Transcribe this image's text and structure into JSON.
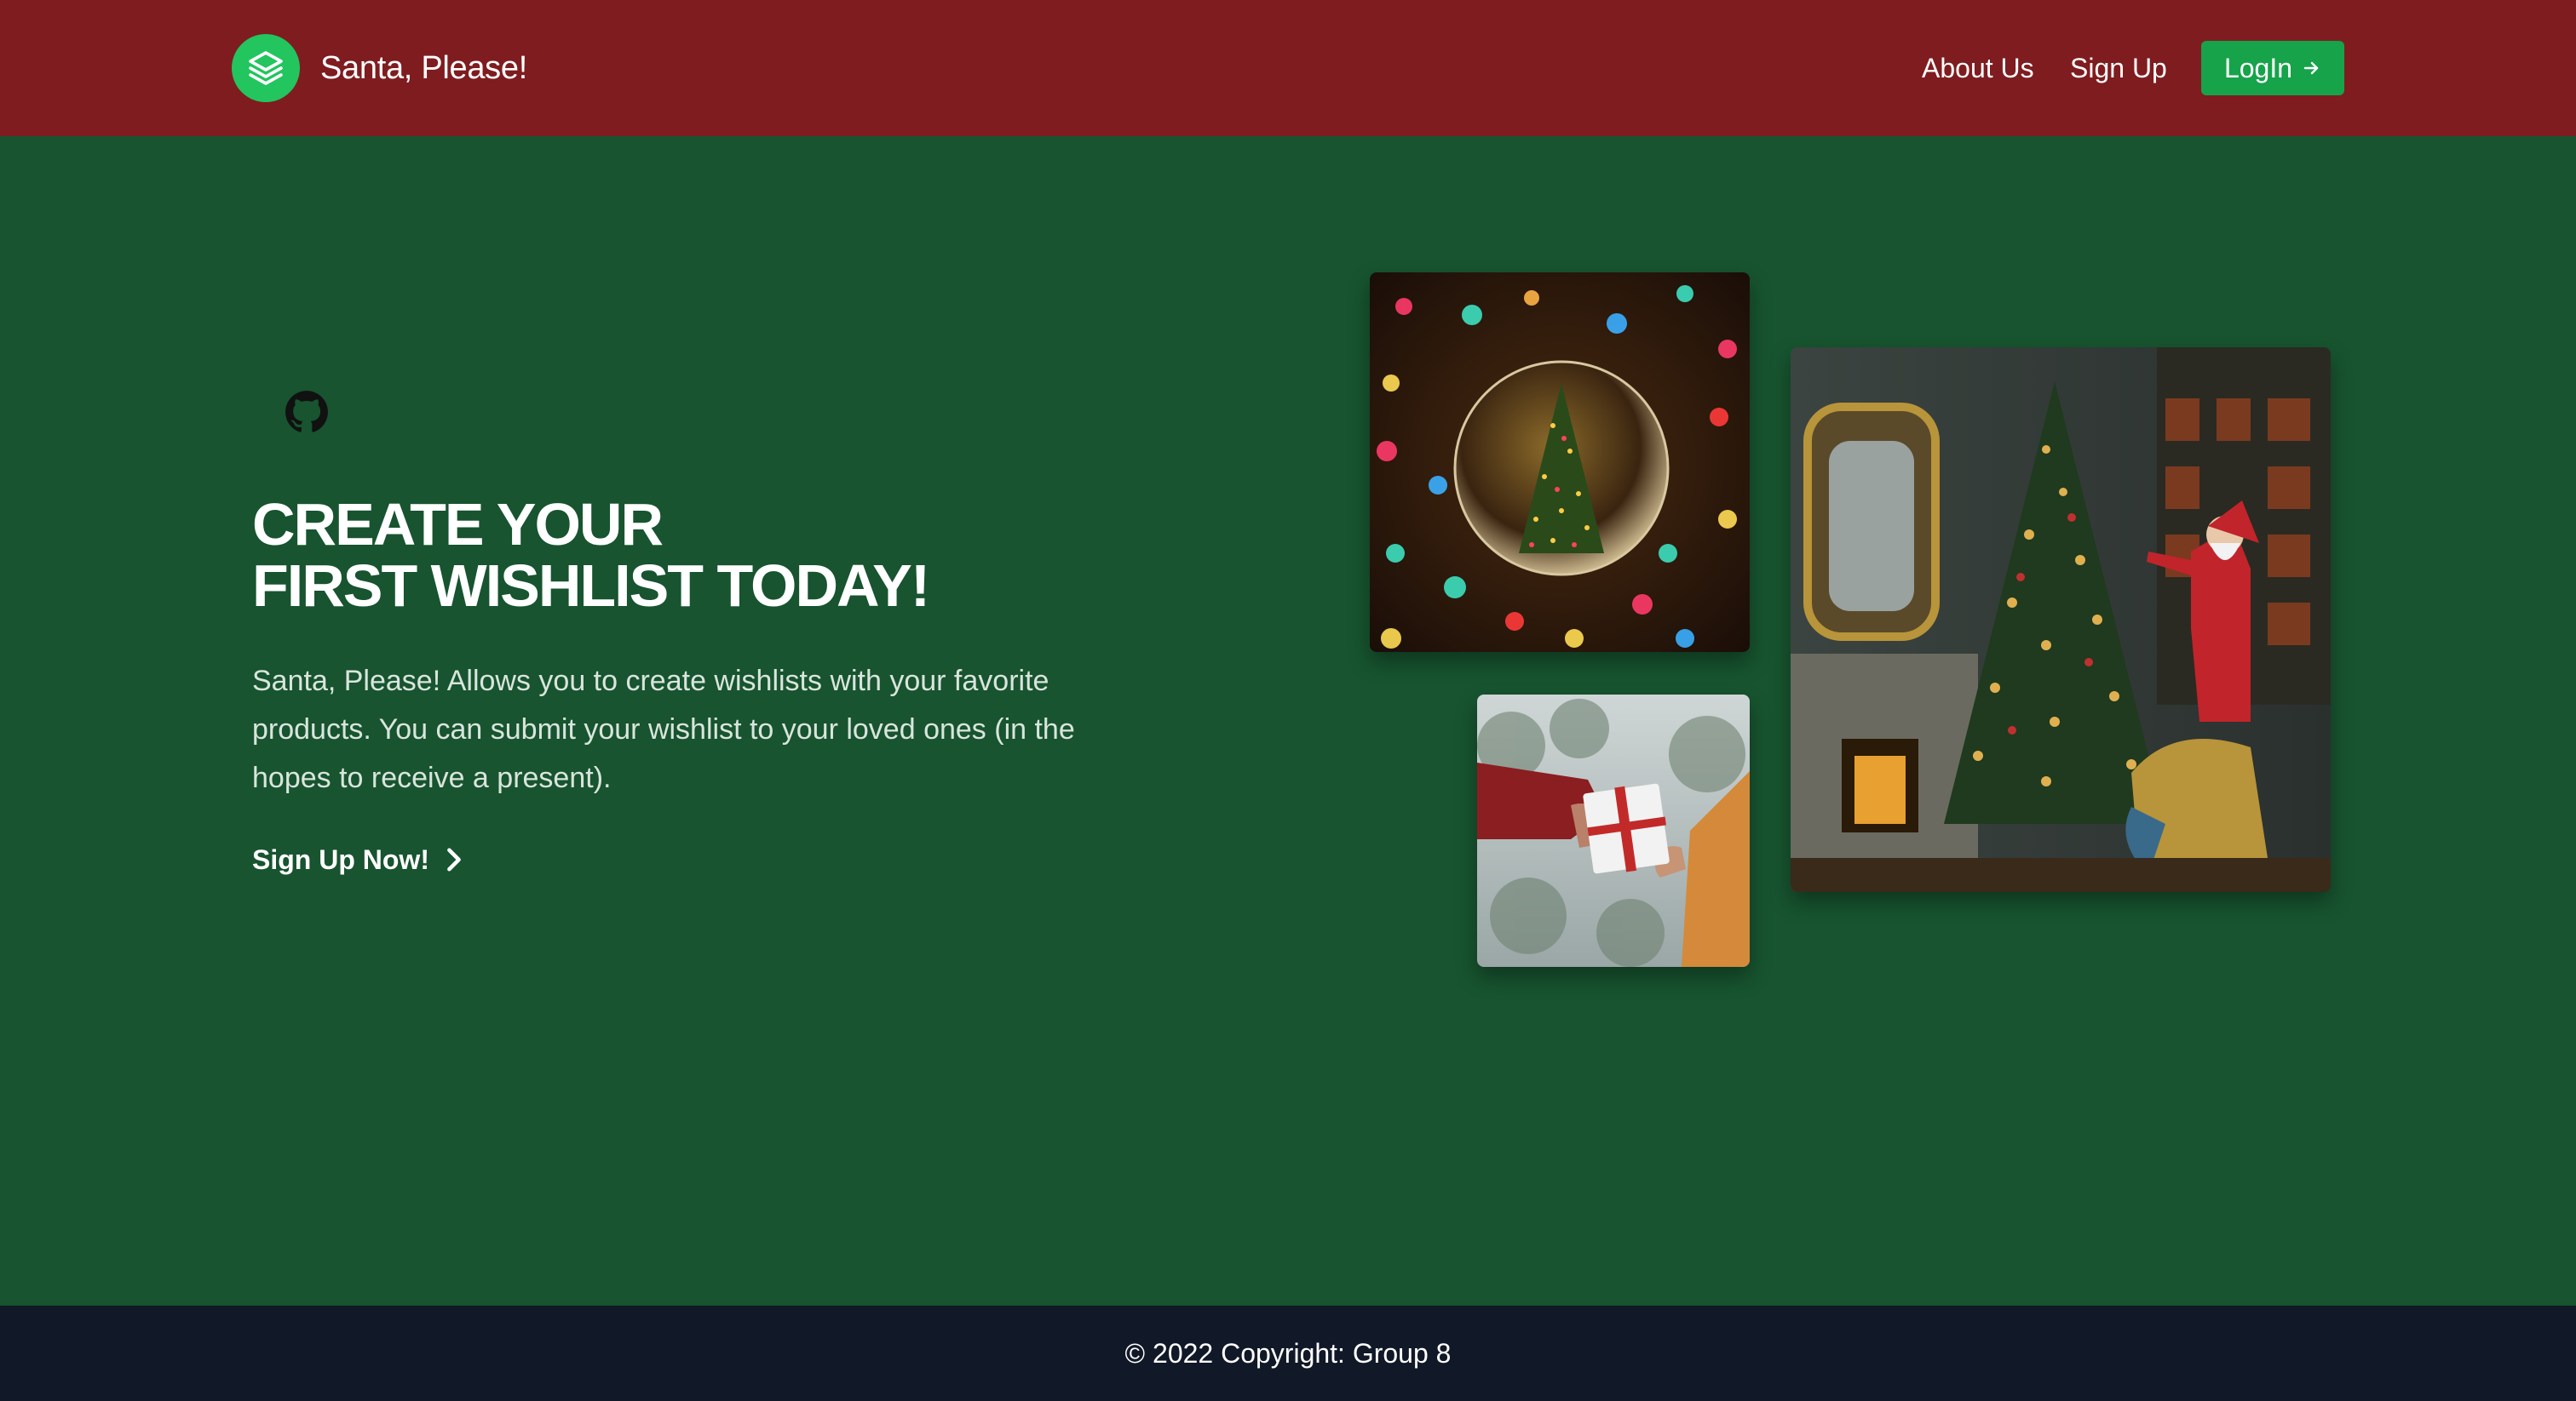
{
  "header": {
    "brand": "Santa, Please!",
    "nav": {
      "about": "About Us",
      "signup": "Sign Up",
      "login": "LogIn"
    }
  },
  "hero": {
    "title_line1": "CREATE YOUR",
    "title_line2": "FIRST WISHLIST TODAY!",
    "description": "Santa, Please! Allows you to create wishlists with your favorite products. You can submit your wishlist to your loved ones (in the hopes to receive a present).",
    "cta": "Sign Up Now!"
  },
  "footer": {
    "copyright": "© 2022 Copyright: Group 8"
  },
  "colors": {
    "header_bg": "#7f1c1f",
    "page_bg": "#17542f",
    "accent_green": "#22c55e",
    "button_green": "#16a34a",
    "footer_bg": "#111827"
  },
  "icons": [
    "layers-icon",
    "arrow-right-icon",
    "github-icon",
    "chevron-right-icon"
  ]
}
